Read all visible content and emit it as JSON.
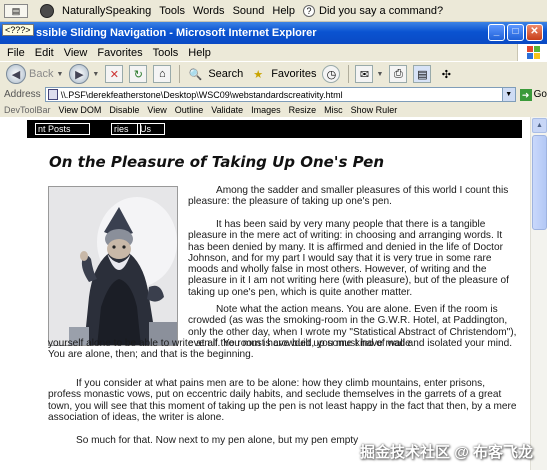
{
  "ns_bar": {
    "drag_label": "",
    "app_name": "NaturallySpeaking",
    "menus": [
      "Tools",
      "Words",
      "Sound",
      "Help"
    ],
    "status": "Did you say a command?"
  },
  "window": {
    "title_tag": "<???>",
    "title": "ssible Sliding Navigation - Microsoft Internet Explorer",
    "buttons": [
      "_",
      "□",
      "✕"
    ]
  },
  "menubar": [
    "File",
    "Edit",
    "View",
    "Favorites",
    "Tools",
    "Help"
  ],
  "toolbar": {
    "back": "Back",
    "search": "Search",
    "favorites": "Favorites"
  },
  "address": {
    "label": "Address",
    "value": "\\\\.PSF\\derekfeatherstone\\Desktop\\WSC09\\webstandardscreativity.html",
    "go": "Go"
  },
  "devbar": {
    "title": "DevToolBar",
    "items": [
      "View DOM",
      "Disable",
      "View",
      "Outline",
      "Validate",
      "Images",
      "Resize",
      "Misc",
      "Show Ruler"
    ]
  },
  "sitenav": {
    "tabs": [
      "nt Posts",
      "ries",
      "Us"
    ]
  },
  "article": {
    "title": "On the Pleasure of Taking Up One's Pen",
    "p1": "Among the sadder and smaller pleasures of this world I count this pleasure: the pleasure of taking up one's pen.",
    "p2": "It has been said by very many people that there is a tangible pleasure in the mere act of writing: in choosing and arranging words. It has been denied by many. It is affirmed and denied in the life of Doctor Johnson, and for my part I would say that it is very true in some rare moods and wholly false in most others. However, of writing and the pleasure in it I am not writing here (with pleasure), but of the pleasure of taking up one's pen, which is quite another matter.",
    "p3": "Note what the action means. You are alone. Even if the room is crowded (as was the smoking-room in the G.W.R. Hotel, at Paddington, only the other day, when I wrote my \"Statistical Abstract of Christendom\"), even if the room is crowded, you must have made",
    "p3b": "yourself alone to be able to write at all. You must have built up some kind of wall and isolated your mind. You are alone, then; and that is the beginning.",
    "p4": "If you consider at what pains men are to be alone: how they climb mountains, enter prisons, profess monastic vows, put on eccentric daily habits, and seclude themselves in the garrets of a great town, you will see that this moment of taking up the pen is not least happy in the fact that then, by a mere association of ideas, the writer is alone.",
    "p5": "So much for that. Now next to my pen alone, but my pen empty"
  },
  "watermark": "掘金技术社区 @ 布客飞龙"
}
